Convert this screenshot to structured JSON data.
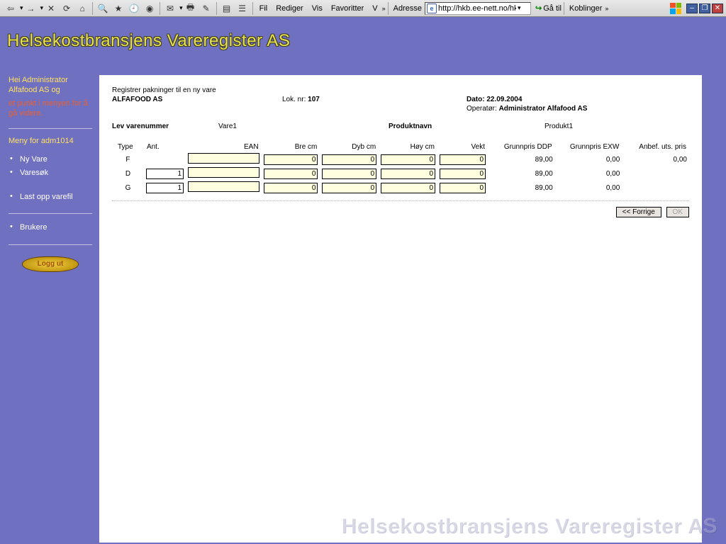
{
  "toolbar": {
    "menus": [
      "Fil",
      "Rediger",
      "Vis",
      "Favoritter",
      "V"
    ],
    "adresse_label": "Adresse",
    "url": "http://hkb.ee-nett.no/hk",
    "ga_til": "Gå til",
    "koblinger": "Koblinger"
  },
  "brand": "Helsekostbransjens Vareregister AS",
  "sidebar": {
    "greeting": "Hei Administrator Alfafood AS og",
    "hint": "et punkt i menyen for å gå videre.",
    "menu_header": "Meny for adm1014",
    "items": [
      "Ny Vare",
      "Varesøk",
      "Last opp varefil",
      "Brukere"
    ],
    "logout": "Logg ut"
  },
  "content": {
    "register_line": "Registrer pakninger til en ny vare",
    "company": "ALFAFOOD AS",
    "lok_label": "Lok. nr:",
    "lok_nr": "107",
    "dato_label": "Dato:",
    "dato": "22.09.2004",
    "operator_label": "Operatør:",
    "operator": "Administrator Alfafood AS",
    "lev_label": "Lev varenummer",
    "lev_value": "Vare1",
    "produktnavn_label": "Produktnavn",
    "produktnavn_value": "Produkt1",
    "headers": {
      "type": "Type",
      "ant": "Ant.",
      "ean": "EAN",
      "bre": "Bre cm",
      "dyb": "Dyb cm",
      "hoy": "Høy cm",
      "vekt": "Vekt",
      "ddp": "Grunnpris DDP",
      "exw": "Grunnpris EXW",
      "anbef": "Anbef. uts. pris"
    },
    "rows": [
      {
        "type": "F",
        "ant": "",
        "ean": "",
        "bre": "0",
        "dyb": "0",
        "hoy": "0",
        "vekt": "0",
        "ddp": "89,00",
        "exw": "0,00",
        "anbef": "0,00"
      },
      {
        "type": "D",
        "ant": "1",
        "ean": "",
        "bre": "0",
        "dyb": "0",
        "hoy": "0",
        "vekt": "0",
        "ddp": "89,00",
        "exw": "0,00",
        "anbef": ""
      },
      {
        "type": "G",
        "ant": "1",
        "ean": "",
        "bre": "0",
        "dyb": "0",
        "hoy": "0",
        "vekt": "0",
        "ddp": "89,00",
        "exw": "0,00",
        "anbef": ""
      }
    ],
    "btn_prev": "<< Forrige",
    "btn_ok": "OK"
  },
  "watermark": "Helsekostbransjens Vareregister AS"
}
